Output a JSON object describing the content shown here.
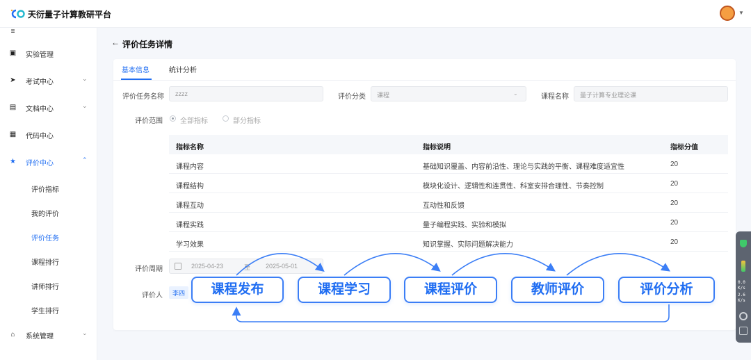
{
  "app": {
    "brand": "天衍量子计算教研平台"
  },
  "sidebar": {
    "items": [
      {
        "label": "实验管理",
        "icon": "experiment-icon"
      },
      {
        "label": "考试中心",
        "icon": "exam-icon"
      },
      {
        "label": "文档中心",
        "icon": "document-icon"
      },
      {
        "label": "代码中心",
        "icon": "code-icon"
      },
      {
        "label": "评价中心",
        "icon": "star-icon"
      },
      {
        "label": "系统管理",
        "icon": "home-icon"
      }
    ],
    "sub_items": [
      "评价指标",
      "我的评价",
      "评价任务",
      "课程排行",
      "讲师排行",
      "学生排行"
    ]
  },
  "page": {
    "title": "评价任务详情"
  },
  "tabs": [
    "基本信息",
    "统计分析"
  ],
  "form": {
    "task_name_label": "评价任务名称",
    "task_name_value": "zzzz",
    "category_label": "评价分类",
    "category_value": "课程",
    "course_label": "课程名称",
    "course_value": "量子计算专业理论课",
    "scope_label": "评价范围",
    "scope_options": [
      "全部指标",
      "部分指标"
    ],
    "scope_selected": "全部指标",
    "period_label": "评价周期",
    "period_start": "2025-04-23",
    "period_sep": "至",
    "period_end": "2025-05-01",
    "evaluator_label": "评价人",
    "evaluator_tag": "李四"
  },
  "table": {
    "headers": [
      "指标名称",
      "指标说明",
      "指标分值"
    ],
    "rows": [
      [
        "课程内容",
        "基础知识覆盖、内容前沿性、理论与实践的平衡、课程难度适宜性",
        "20"
      ],
      [
        "课程结构",
        "模块化设计、逻辑性和连贯性、科室安排合理性、节奏控制",
        "20"
      ],
      [
        "课程互动",
        "互动性和反馈",
        "20"
      ],
      [
        "课程实践",
        "量子编程实践、实验和模拟",
        "20"
      ],
      [
        "学习效果",
        "知识掌握、实际问题解决能力",
        "20"
      ]
    ]
  },
  "flow": {
    "steps": [
      "课程发布",
      "课程学习",
      "课程评价",
      "教师评价",
      "评价分析"
    ],
    "color": "#3b7ef6"
  },
  "widget": {
    "up": "0.0",
    "down": "2.6",
    "unit": "K/s"
  },
  "colors": {
    "accent": "#1f6df2"
  }
}
